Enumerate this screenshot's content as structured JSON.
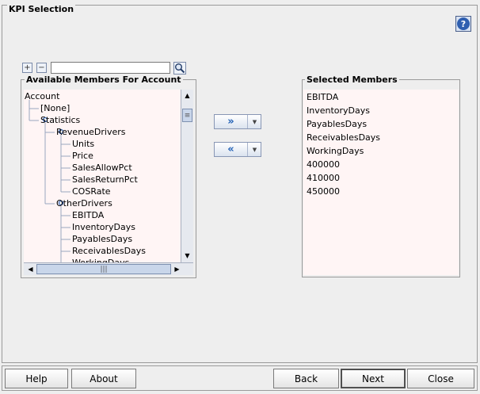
{
  "window": {
    "title": "KPI Selection",
    "help_glyph": "?"
  },
  "toolbar": {
    "expand_glyph": "+",
    "collapse_glyph": "−",
    "search_value": "",
    "search_icon": "magnifier-icon"
  },
  "available": {
    "title": "Available Members For Account",
    "tree": [
      {
        "label": "Account",
        "level": 0,
        "expander": false
      },
      {
        "label": "[None]",
        "level": 1,
        "expander": false
      },
      {
        "label": "Statistics",
        "level": 1,
        "expander": true
      },
      {
        "label": "RevenueDrivers",
        "level": 2,
        "expander": true
      },
      {
        "label": "Units",
        "level": 3,
        "expander": false
      },
      {
        "label": "Price",
        "level": 3,
        "expander": false
      },
      {
        "label": "SalesAllowPct",
        "level": 3,
        "expander": false
      },
      {
        "label": "SalesReturnPct",
        "level": 3,
        "expander": false
      },
      {
        "label": "COSRate",
        "level": 3,
        "expander": false
      },
      {
        "label": "OtherDrivers",
        "level": 2,
        "expander": true
      },
      {
        "label": "EBITDA",
        "level": 3,
        "expander": false
      },
      {
        "label": "InventoryDays",
        "level": 3,
        "expander": false
      },
      {
        "label": "PayablesDays",
        "level": 3,
        "expander": false
      },
      {
        "label": "ReceivablesDays",
        "level": 3,
        "expander": false
      },
      {
        "label": "WorkingDays",
        "level": 3,
        "expander": false
      }
    ],
    "vscroll_fraction": 0.05
  },
  "move": {
    "add_glyph": "»",
    "remove_glyph": "«",
    "dropdown_glyph": "▼"
  },
  "selected": {
    "title": "Selected Members",
    "items": [
      "EBITDA",
      "InventoryDays",
      "PayablesDays",
      "ReceivablesDays",
      "WorkingDays",
      "400000",
      "410000",
      "450000"
    ]
  },
  "footer": {
    "help_label": "Help",
    "about_label": "About",
    "back_label": "Back",
    "next_label": "Next",
    "close_label": "Close"
  },
  "colors": {
    "accent": "#2f5fb0",
    "list_bg": "#fff5f5",
    "tree_line": "#9aa6c0"
  }
}
